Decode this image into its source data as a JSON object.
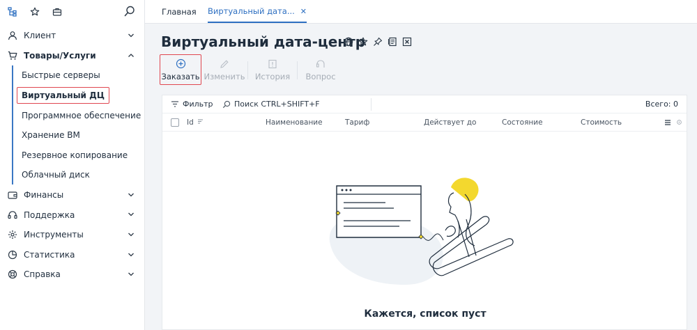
{
  "tabs": [
    {
      "label": "Главная"
    },
    {
      "label": "Виртуальный дата..."
    }
  ],
  "sidebar": {
    "items": [
      {
        "label": "Клиент",
        "icon": "user-icon"
      },
      {
        "label": "Товары/Услуги",
        "icon": "cart-icon",
        "expanded": true
      },
      {
        "label": "Финансы",
        "icon": "wallet-icon"
      },
      {
        "label": "Поддержка",
        "icon": "headset-icon"
      },
      {
        "label": "Инструменты",
        "icon": "gear-icon"
      },
      {
        "label": "Статистика",
        "icon": "pie-chart-icon"
      },
      {
        "label": "Справка",
        "icon": "lifebuoy-icon"
      }
    ],
    "subitems": [
      {
        "label": "Быстрые серверы"
      },
      {
        "label": "Виртуальный ДЦ",
        "active": true
      },
      {
        "label": "Программное обеспечение"
      },
      {
        "label": "Хранение ВМ"
      },
      {
        "label": "Резервное копирование"
      },
      {
        "label": "Облачный диск"
      }
    ]
  },
  "page": {
    "title": "Виртуальный дата-центр"
  },
  "toolbar": {
    "order": "Заказать",
    "edit": "Изменить",
    "history": "История",
    "question": "Вопрос"
  },
  "filterbar": {
    "filter": "Фильтр",
    "search_placeholder": "Поиск CTRL+SHIFT+F",
    "total": "Всего: 0"
  },
  "table": {
    "columns": [
      "Id",
      "Наименование",
      "Тариф",
      "Действует до",
      "Состояние",
      "Стоимость"
    ]
  },
  "empty": {
    "message": "Кажется, список пуст"
  },
  "colors": {
    "accent": "#2d6fc1",
    "highlight": "#e0464f",
    "illustration_yellow": "#f3d82e"
  }
}
